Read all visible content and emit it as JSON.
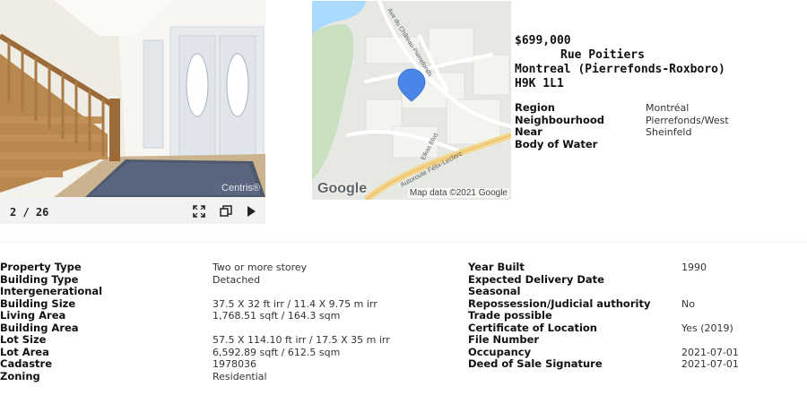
{
  "photo": {
    "counter": "2 / 26",
    "watermark": "Centris®",
    "icons": [
      "fullscreen-icon",
      "copy-icon",
      "play-icon"
    ]
  },
  "map": {
    "brand": "Google",
    "attribution": "Map data ©2021 Google",
    "street_1": "Ave du Château-Pierrefonds",
    "street_2": "Elkas Blvd",
    "street_3": "Autoroute Félix-Leclerc",
    "marker_color": "#4a86e8"
  },
  "listing": {
    "price": "$699,000",
    "street": "Rue Poitiers",
    "city": "Montreal (Pierrefonds-Roxboro)",
    "postal": "H9K 1L1"
  },
  "region_info": [
    {
      "label": "Region",
      "value": "Montréal"
    },
    {
      "label": "Neighbourhood",
      "value": "Pierrefonds/West"
    },
    {
      "label": "Near",
      "value": "Sheinfeld"
    },
    {
      "label": "Body of Water",
      "value": ""
    }
  ],
  "details_left": [
    {
      "label": "Property Type",
      "value": "Two or more storey"
    },
    {
      "label": "Building Type",
      "value": "Detached"
    },
    {
      "label": "Intergenerational",
      "value": ""
    },
    {
      "label": "Building Size",
      "value": "37.5 X 32 ft irr / 11.4 X 9.75 m irr"
    },
    {
      "label": "Living Area",
      "value": "1,768.51 sqft / 164.3 sqm"
    },
    {
      "label": "Building Area",
      "value": ""
    },
    {
      "label": "Lot Size",
      "value": "57.5 X 114.10 ft irr / 17.5 X 35 m irr"
    },
    {
      "label": "Lot Area",
      "value": "6,592.89 sqft / 612.5 sqm"
    },
    {
      "label": "Cadastre",
      "value": "1978036"
    },
    {
      "label": "Zoning",
      "value": "Residential"
    }
  ],
  "details_right": [
    {
      "label": "Year Built",
      "value": "1990"
    },
    {
      "label": "Expected Delivery Date",
      "value": ""
    },
    {
      "label": "Seasonal",
      "value": ""
    },
    {
      "label": "Repossession/Judicial authority",
      "value": "No"
    },
    {
      "label": "Trade possible",
      "value": ""
    },
    {
      "label": "Certificate of Location",
      "value": "Yes (2019)"
    },
    {
      "label": "File Number",
      "value": ""
    },
    {
      "label": "Occupancy",
      "value": "2021-07-01"
    },
    {
      "label": "Deed of Sale Signature",
      "value": "2021-07-01"
    }
  ]
}
